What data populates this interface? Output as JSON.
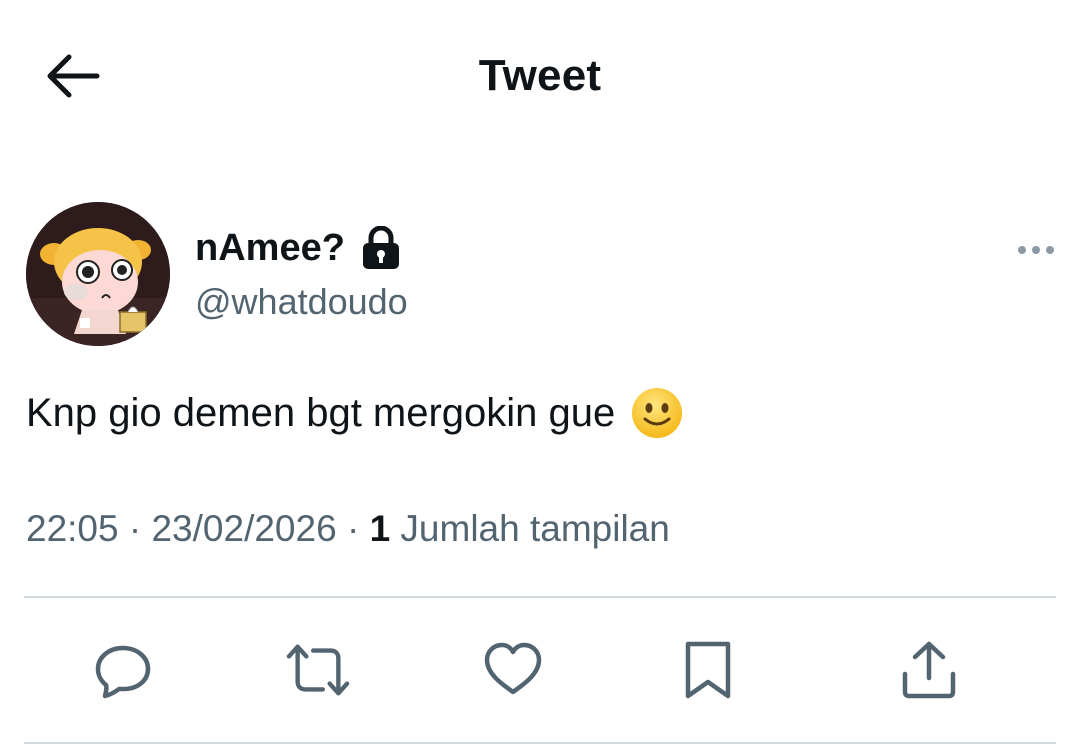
{
  "header": {
    "title": "Tweet",
    "back_icon": "arrow-left-icon"
  },
  "tweet": {
    "author": {
      "display_name": "nAmee?",
      "handle": "@whatdoudo",
      "protected_icon": "lock-icon",
      "avatar": "cartoon-avatar"
    },
    "text": "Knp gio demen bgt mergokin gue",
    "emoji": "slightly-smiling-face",
    "time": "22:05",
    "separator1": " · ",
    "date": "23/02/2026",
    "separator2": " · ",
    "view_count": "1",
    "view_label": " Jumlah tampilan",
    "more_icon": "more-horizontal-icon"
  },
  "actions": [
    {
      "name": "reply",
      "icon": "reply-icon"
    },
    {
      "name": "retweet",
      "icon": "retweet-icon"
    },
    {
      "name": "like",
      "icon": "heart-icon"
    },
    {
      "name": "bookmark",
      "icon": "bookmark-icon"
    },
    {
      "name": "share",
      "icon": "share-icon"
    }
  ],
  "colors": {
    "text_primary": "#0f1419",
    "text_secondary": "#536471",
    "divider": "#cfd9de"
  }
}
